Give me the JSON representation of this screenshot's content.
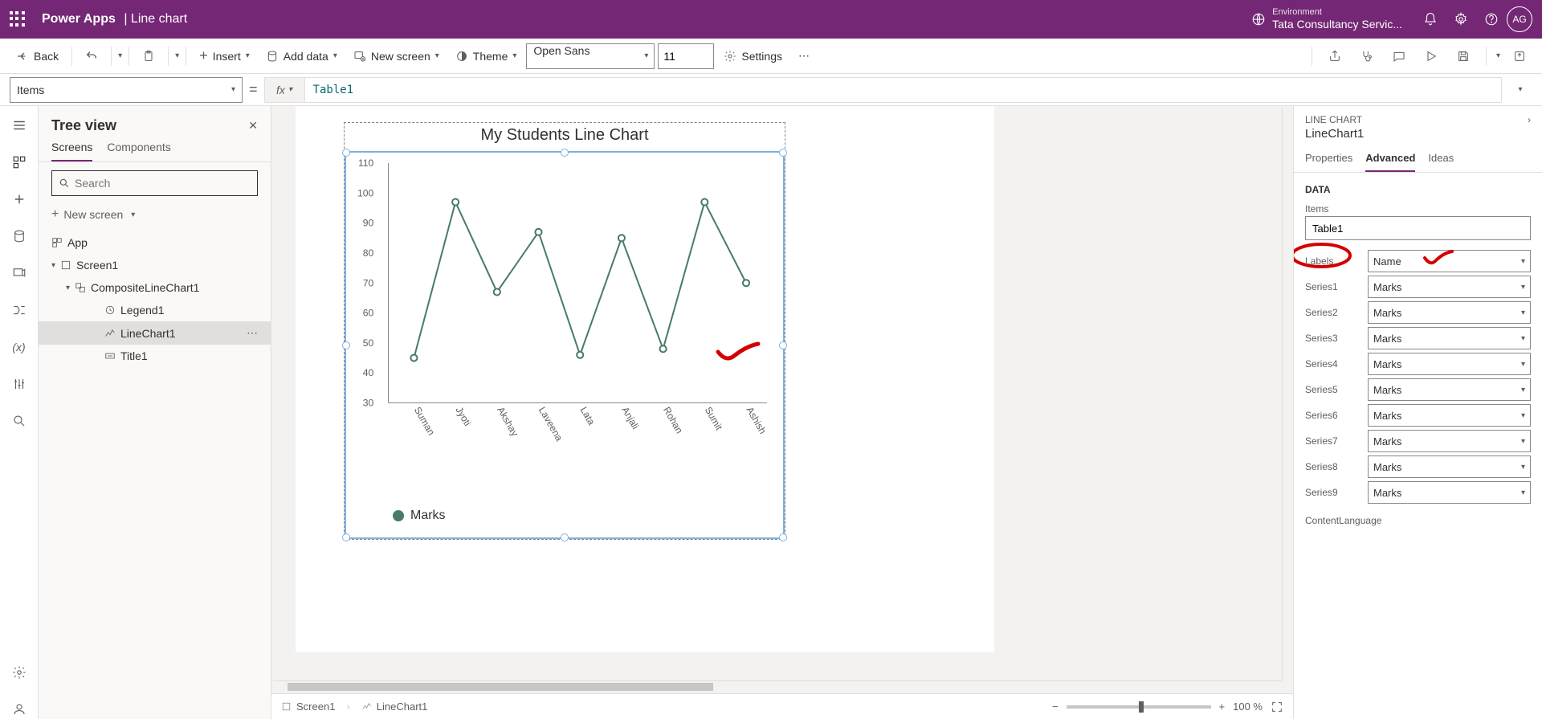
{
  "header": {
    "app": "Power Apps",
    "page": "Line chart",
    "env_label": "Environment",
    "env_name": "Tata Consultancy Servic...",
    "avatar": "AG"
  },
  "cmdbar": {
    "back": "Back",
    "insert": "Insert",
    "add_data": "Add data",
    "new_screen": "New screen",
    "theme": "Theme",
    "font": "Open Sans",
    "font_size": "11",
    "settings": "Settings"
  },
  "formula": {
    "property": "Items",
    "fx": "fx",
    "value": "Table1"
  },
  "tree": {
    "title": "Tree view",
    "tab_screens": "Screens",
    "tab_components": "Components",
    "search_placeholder": "Search",
    "new_screen": "New screen",
    "app": "App",
    "screen1": "Screen1",
    "composite": "CompositeLineChart1",
    "legend": "Legend1",
    "linechart": "LineChart1",
    "title1": "Title1"
  },
  "right": {
    "type": "LINE CHART",
    "name": "LineChart1",
    "tab_props": "Properties",
    "tab_adv": "Advanced",
    "tab_ideas": "Ideas",
    "section_data": "DATA",
    "items_label": "Items",
    "items_value": "Table1",
    "labels_label": "Labels",
    "labels_value": "Name",
    "series_label_prefix": "Series",
    "series_value": "Marks",
    "content_lang": "ContentLanguage"
  },
  "status": {
    "screen": "Screen1",
    "control": "LineChart1",
    "zoom": "100 %"
  },
  "chart_data": {
    "type": "line",
    "title": "My Students Line Chart",
    "ylabel": "",
    "xlabel": "",
    "ylim": [
      30,
      110
    ],
    "yticks": [
      30,
      40,
      50,
      60,
      70,
      80,
      90,
      100,
      110
    ],
    "categories": [
      "Suman",
      "Jyoti",
      "Akshay",
      "Laveena",
      "Lata",
      "Anjali",
      "Rohan",
      "Sumit",
      "Ashish"
    ],
    "series": [
      {
        "name": "Marks",
        "values": [
          45,
          97,
          67,
          87,
          46,
          85,
          48,
          97,
          70
        ]
      }
    ],
    "legend": "Marks"
  }
}
